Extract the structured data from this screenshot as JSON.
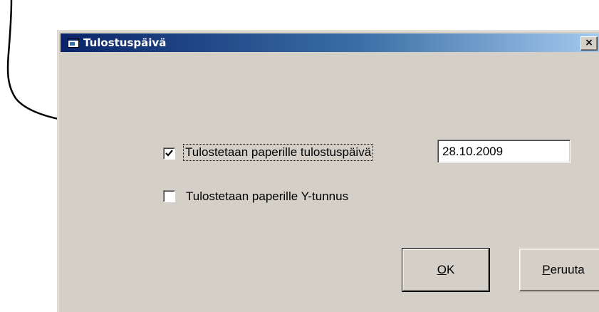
{
  "dialog": {
    "title": "Tulostuspäivä",
    "close_label": "×"
  },
  "options": {
    "print_date": {
      "label": "Tulostetaan paperille tulostuspäivä",
      "checked": true,
      "value": "28.10.2009"
    },
    "print_business_id": {
      "label": "Tulostetaan paperille Y-tunnus",
      "checked": false
    }
  },
  "buttons": {
    "ok_mnemonic": "O",
    "ok_rest": "K",
    "cancel_mnemonic": "P",
    "cancel_rest": "eruuta"
  },
  "icons": {
    "window": "window-icon",
    "close": "close-icon",
    "checkmark": "checkmark-icon",
    "annotation": "hand-drawn-arrow-icon"
  },
  "colors": {
    "dialog_bg": "#d4d0c8",
    "title_start": "#0a246a",
    "title_end": "#a6caf0"
  }
}
